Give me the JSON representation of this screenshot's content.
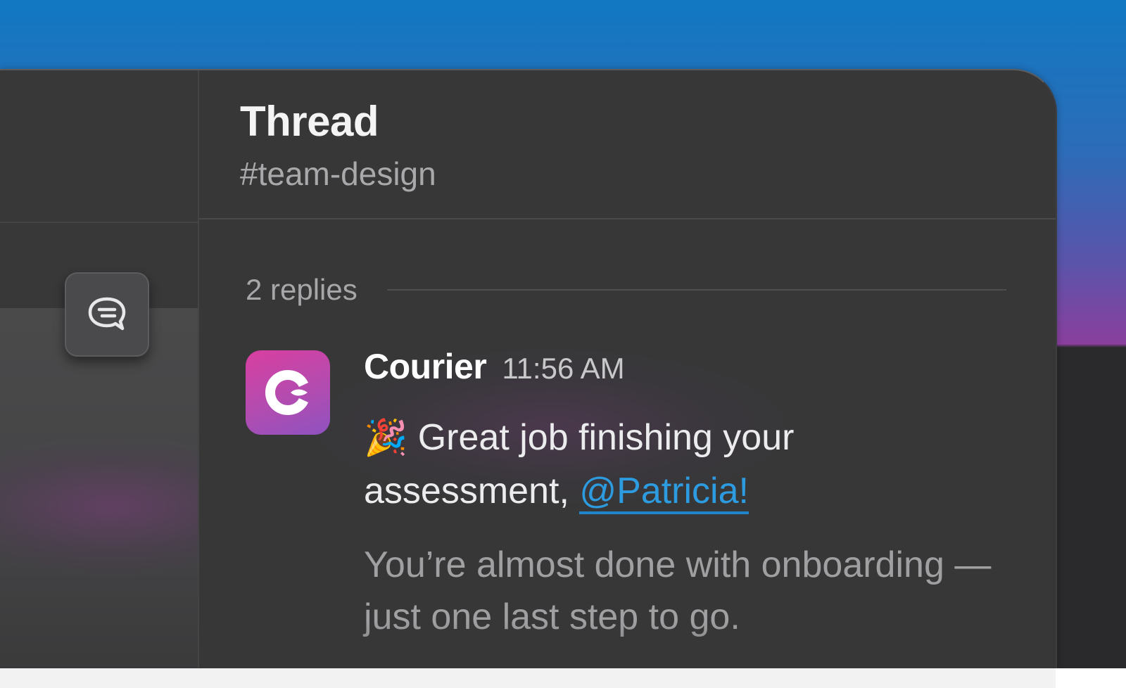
{
  "thread": {
    "title": "Thread",
    "channel": "#team-design",
    "replies": "2 replies"
  },
  "message": {
    "sender": "Courier",
    "time": "11:56 AM",
    "emoji": "🎉",
    "line_1": "Great job finishing your assessment, ",
    "mention": "@Patricia!",
    "line_2": "You’re almost done with onboarding — just one last step to go."
  },
  "icons": {
    "thread_button": "thread-bubble-icon",
    "avatar": "courier-logo-icon"
  },
  "colors": {
    "window_bg": "#373738",
    "mention": "#2d9be0",
    "avatar_gradient_start": "#d83fa0",
    "avatar_gradient_end": "#8e52c0",
    "backdrop_top": "#1178c2",
    "backdrop_mid": "#8a3f9d"
  }
}
